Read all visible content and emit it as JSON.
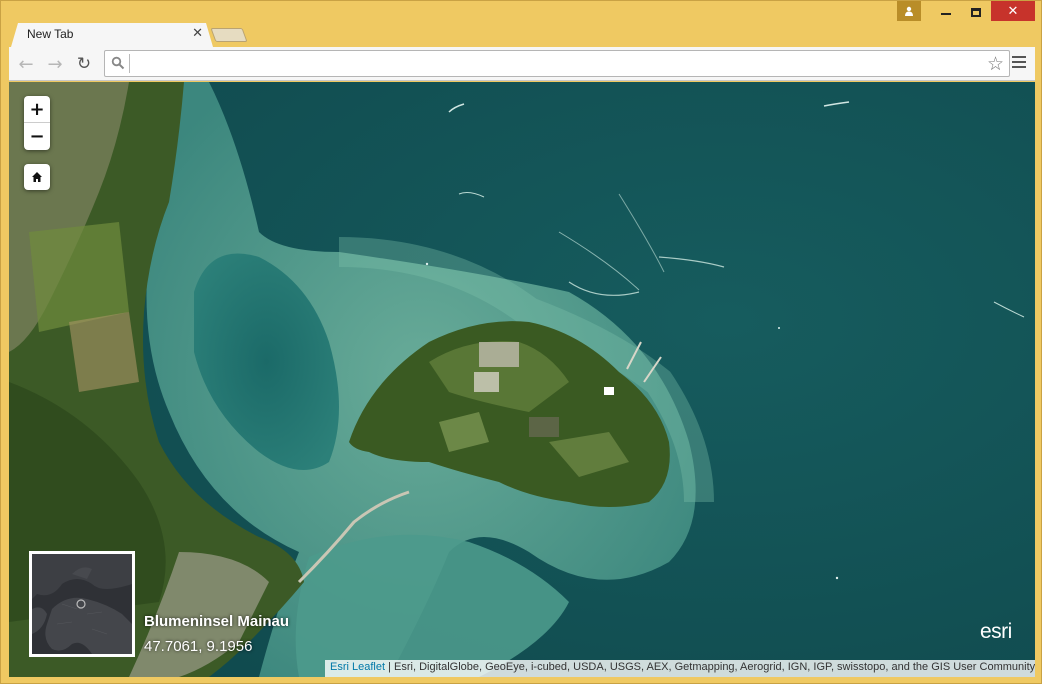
{
  "browser": {
    "tab_title": "New Tab",
    "tab_close_glyph": "✕",
    "back_glyph": "←",
    "forward_glyph": "→",
    "reload_glyph": "↻",
    "star_glyph": "☆",
    "omnibox_value": "",
    "window_close_glyph": "✕"
  },
  "map": {
    "zoom_in_label": "+",
    "zoom_out_label": "−",
    "place_name": "Blumeninsel Mainau",
    "place_coords": "47.7061, 9.1956",
    "logo_text": "esri",
    "attribution_link": "Esri Leaflet",
    "attribution_separator": " | ",
    "attribution_text": "Esri, DigitalGlobe, GeoEye, i-cubed, USDA, USGS, AEX, Getmapping, Aerogrid, IGN, IGP, swisstopo, and the GIS User Community"
  },
  "icons": {
    "profile": "profile-icon",
    "minimize": "minimize-icon",
    "maximize": "maximize-icon",
    "close": "close-icon",
    "search": "search-icon",
    "star": "star-icon",
    "menu": "hamburger-menu-icon",
    "home": "home-icon"
  },
  "colors": {
    "window_frame": "#efc962",
    "lake_water": "#14565a",
    "shallow_water": "#5aa394",
    "land": "#3f5f2a",
    "attribution_link": "#0078a8"
  }
}
